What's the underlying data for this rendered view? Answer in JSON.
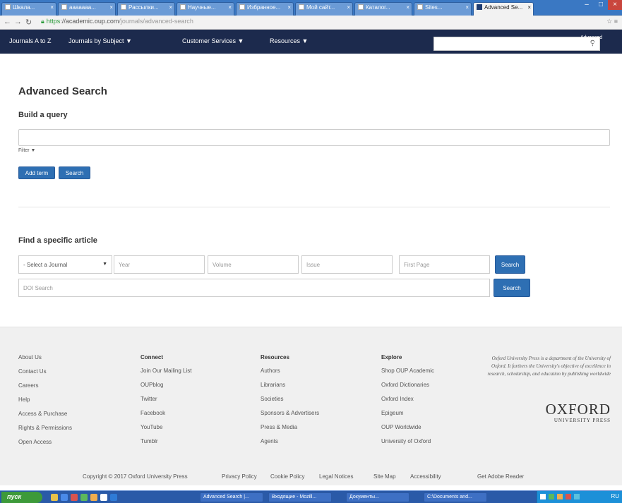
{
  "browser": {
    "tabs": [
      {
        "label": "Шкала..."
      },
      {
        "label": "ааааааа..."
      },
      {
        "label": "Рассылки..."
      },
      {
        "label": "Научные..."
      },
      {
        "label": "Избранное..."
      },
      {
        "label": "Мой сайт..."
      },
      {
        "label": "Каталог..."
      },
      {
        "label": "Sites..."
      },
      {
        "label": "Advanced Se..."
      }
    ],
    "url_scheme": "https",
    "url_host": "://academic.oup.com",
    "url_path": "/journals/advanced-search"
  },
  "site_nav": {
    "items": [
      {
        "label": "Journals A to Z"
      },
      {
        "label": "Journals by Subject ▼"
      },
      {
        "label": "Customer Services ▼"
      },
      {
        "label": "Resources ▼"
      }
    ],
    "search_placeholder": "",
    "advanced_search_label": "Advanced Search"
  },
  "main": {
    "title": "Advanced Search",
    "build_heading": "Build a query",
    "query_placeholder": "",
    "filter_label": "Filter ▼",
    "add_term_label": "Add term",
    "search_label": "Search",
    "find_heading": "Find a specific article",
    "journal_select_value": "- Select a Journal",
    "year_placeholder": "Year",
    "volume_placeholder": "Volume",
    "issue_placeholder": "Issue",
    "first_page_placeholder": "First Page",
    "article_search_label": "Search",
    "doi_placeholder": "DOI Search",
    "doi_search_label": "Search"
  },
  "footer": {
    "col1": {
      "heading": "",
      "links": [
        "About Us",
        "Contact Us",
        "Careers",
        "Help",
        "Access & Purchase",
        "Rights & Permissions",
        "Open Access"
      ]
    },
    "col2": {
      "heading": "Connect",
      "links": [
        "Join Our Mailing List",
        "OUPblog",
        "Twitter",
        "Facebook",
        "YouTube",
        "Tumblr"
      ]
    },
    "col3": {
      "heading": "Resources",
      "links": [
        "Authors",
        "Librarians",
        "Societies",
        "Sponsors & Advertisers",
        "Press & Media",
        "Agents"
      ]
    },
    "col4": {
      "heading": "Explore",
      "links": [
        "Shop OUP Academic",
        "Oxford Dictionaries",
        "Oxford Index",
        "Epigeum",
        "OUP Worldwide",
        "University of Oxford"
      ]
    },
    "oup_text": "Oxford University Press is a department of the University of Oxford. It furthers the University's objective of excellence in research, scholarship, and education by publishing worldwide",
    "logo_main": "OXFORD",
    "logo_sub": "UNIVERSITY PRESS",
    "bottom": [
      "Copyright © 2017 Oxford University Press",
      "Privacy Policy",
      "Cookie Policy",
      "Legal Notices",
      "Site Map",
      "Accessibility",
      "Get Adobe Reader"
    ]
  },
  "taskbar": {
    "start_label": "пуск",
    "tasks": [
      {
        "label": "Advanced Search |..."
      },
      {
        "label": "Входящие - Mozill..."
      },
      {
        "label": "Документы..."
      },
      {
        "label": "С:\\Documents and..."
      }
    ],
    "tray_label": "RU"
  },
  "colors": {
    "site_nav_bg": "#1c2a4d",
    "button_blue": "#2e6fb3",
    "footer_bg": "#f0f0f0",
    "taskbar_bg": "#2a5aa8"
  }
}
